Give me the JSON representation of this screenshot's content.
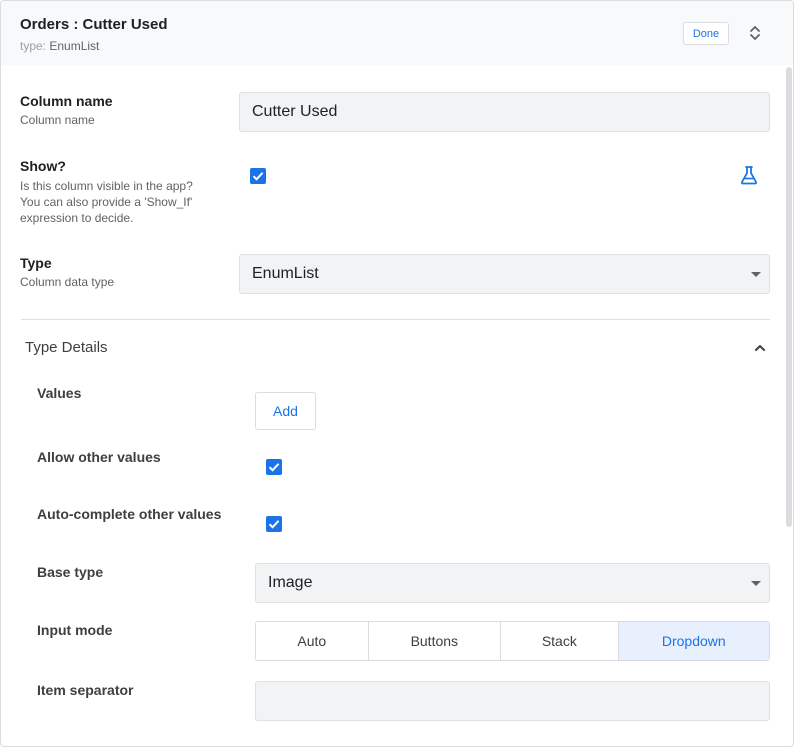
{
  "header": {
    "title": "Orders : Cutter Used",
    "type_prefix": "type:",
    "type_value": "EnumList",
    "done_label": "Done",
    "expand_icon": "unfold-more-icon"
  },
  "column_name": {
    "label": "Column name",
    "description": "Column name",
    "value": "Cutter Used"
  },
  "show": {
    "label": "Show?",
    "description_lines": [
      "Is this column visible in the app?",
      "You can also provide a 'Show_If'",
      "expression to decide."
    ],
    "checked": true,
    "test_icon": "flask-icon"
  },
  "type": {
    "label": "Type",
    "description": "Column data type",
    "value": "EnumList"
  },
  "type_details": {
    "title": "Type Details",
    "collapse_icon": "chevron-up-icon",
    "values": {
      "label": "Values",
      "add_label": "Add"
    },
    "allow_other": {
      "label": "Allow other values",
      "checked": true
    },
    "autocomplete_other": {
      "label": "Auto-complete other values",
      "checked": true
    },
    "base_type": {
      "label": "Base type",
      "value": "Image"
    },
    "input_mode": {
      "label": "Input mode",
      "options": [
        "Auto",
        "Buttons",
        "Stack",
        "Dropdown"
      ],
      "selected": "Dropdown"
    },
    "item_separator": {
      "label": "Item separator",
      "value": ""
    }
  },
  "colors": {
    "accent": "#1a73e8",
    "header_bg": "#f8f9fa",
    "field_bg": "#f1f3f4",
    "selected_bg": "#e8f0fe"
  }
}
